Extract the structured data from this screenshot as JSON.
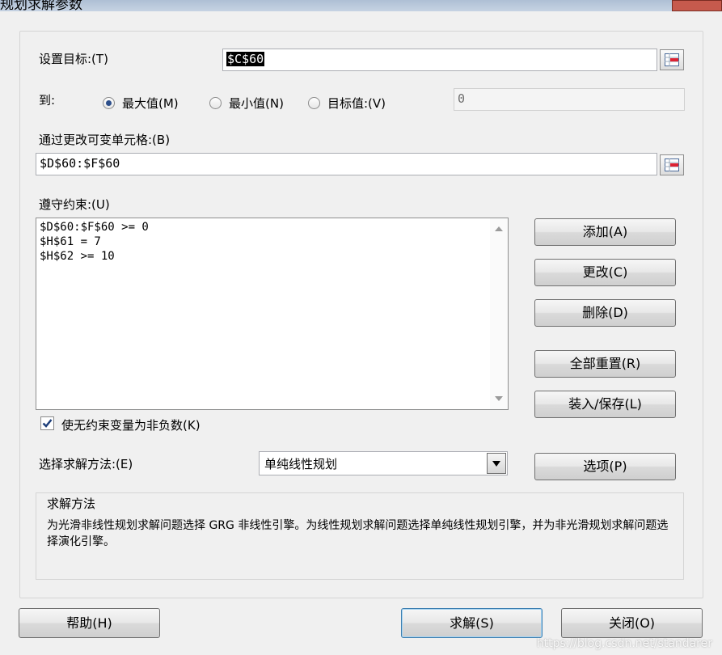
{
  "window": {
    "title": "规划求解参数"
  },
  "objective": {
    "label": "设置目标:(T)",
    "value": "$C$60"
  },
  "to": {
    "label": "到:",
    "options": [
      {
        "label": "最大值(M)",
        "checked": true
      },
      {
        "label": "最小值(N)",
        "checked": false
      },
      {
        "label": "目标值:(V)",
        "checked": false
      }
    ],
    "target_value": "0"
  },
  "changing_cells": {
    "label": "通过更改可变单元格:(B)",
    "value": "$D$60:$F$60"
  },
  "constraints": {
    "label": "遵守约束:(U)",
    "items": [
      "$D$60:$F$60 >= 0",
      "$H$61 = 7",
      "$H$62 >= 10"
    ]
  },
  "side_buttons": {
    "add": "添加(A)",
    "change": "更改(C)",
    "delete": "删除(D)",
    "reset_all": "全部重置(R)",
    "load_save": "装入/保存(L)",
    "options": "选项(P)"
  },
  "nonneg_checkbox": {
    "label": "使无约束变量为非负数(K)",
    "checked": true
  },
  "method": {
    "label": "选择求解方法:(E)",
    "selected": "单纯线性规划"
  },
  "method_group": {
    "title": "求解方法",
    "description": "为光滑非线性规划求解问题选择 GRG 非线性引擎。为线性规划求解问题选择单纯线性规划引擎，并为非光滑规划求解问题选择演化引擎。"
  },
  "footer": {
    "help": "帮助(H)",
    "solve": "求解(S)",
    "close": "关闭(O)"
  },
  "watermark": "https://blog.csdn.net/standarer"
}
